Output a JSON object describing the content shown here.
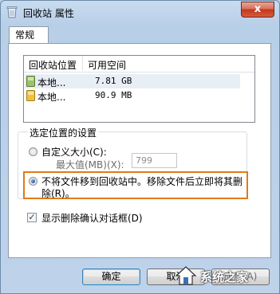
{
  "window": {
    "title": "回收站 属性",
    "close_label": "x"
  },
  "tabs": [
    {
      "label": "常规"
    }
  ],
  "listview": {
    "columns": [
      "回收站位置",
      "可用空间"
    ],
    "rows": [
      {
        "location": "本地...",
        "space": "7.81 GB",
        "icon": "drive-icon",
        "selected": true
      },
      {
        "location": "本地...",
        "space": "90.9 MB",
        "icon": "drive-icon",
        "selected": false
      }
    ]
  },
  "settings_group": {
    "legend": "选定位置的设置",
    "custom_size_label": "自定义大小(C):",
    "max_value_label": "最大值(MB)(X):",
    "max_value": "799",
    "no_recycle_label_line1": "不将文件移到回收站中。移除文件后立即将其删",
    "no_recycle_label_line2": "除(R)。"
  },
  "confirm_checkbox": {
    "label": "显示删除确认对话框(D)",
    "checked": true
  },
  "buttons": {
    "ok": "确定",
    "cancel": "取消",
    "apply": "应用(A)"
  },
  "watermark": {
    "text": "系统之家"
  },
  "colors": {
    "highlight_border": "#e07a1b",
    "close_button": "#c2381d",
    "titlebar": "#c9dcef"
  }
}
